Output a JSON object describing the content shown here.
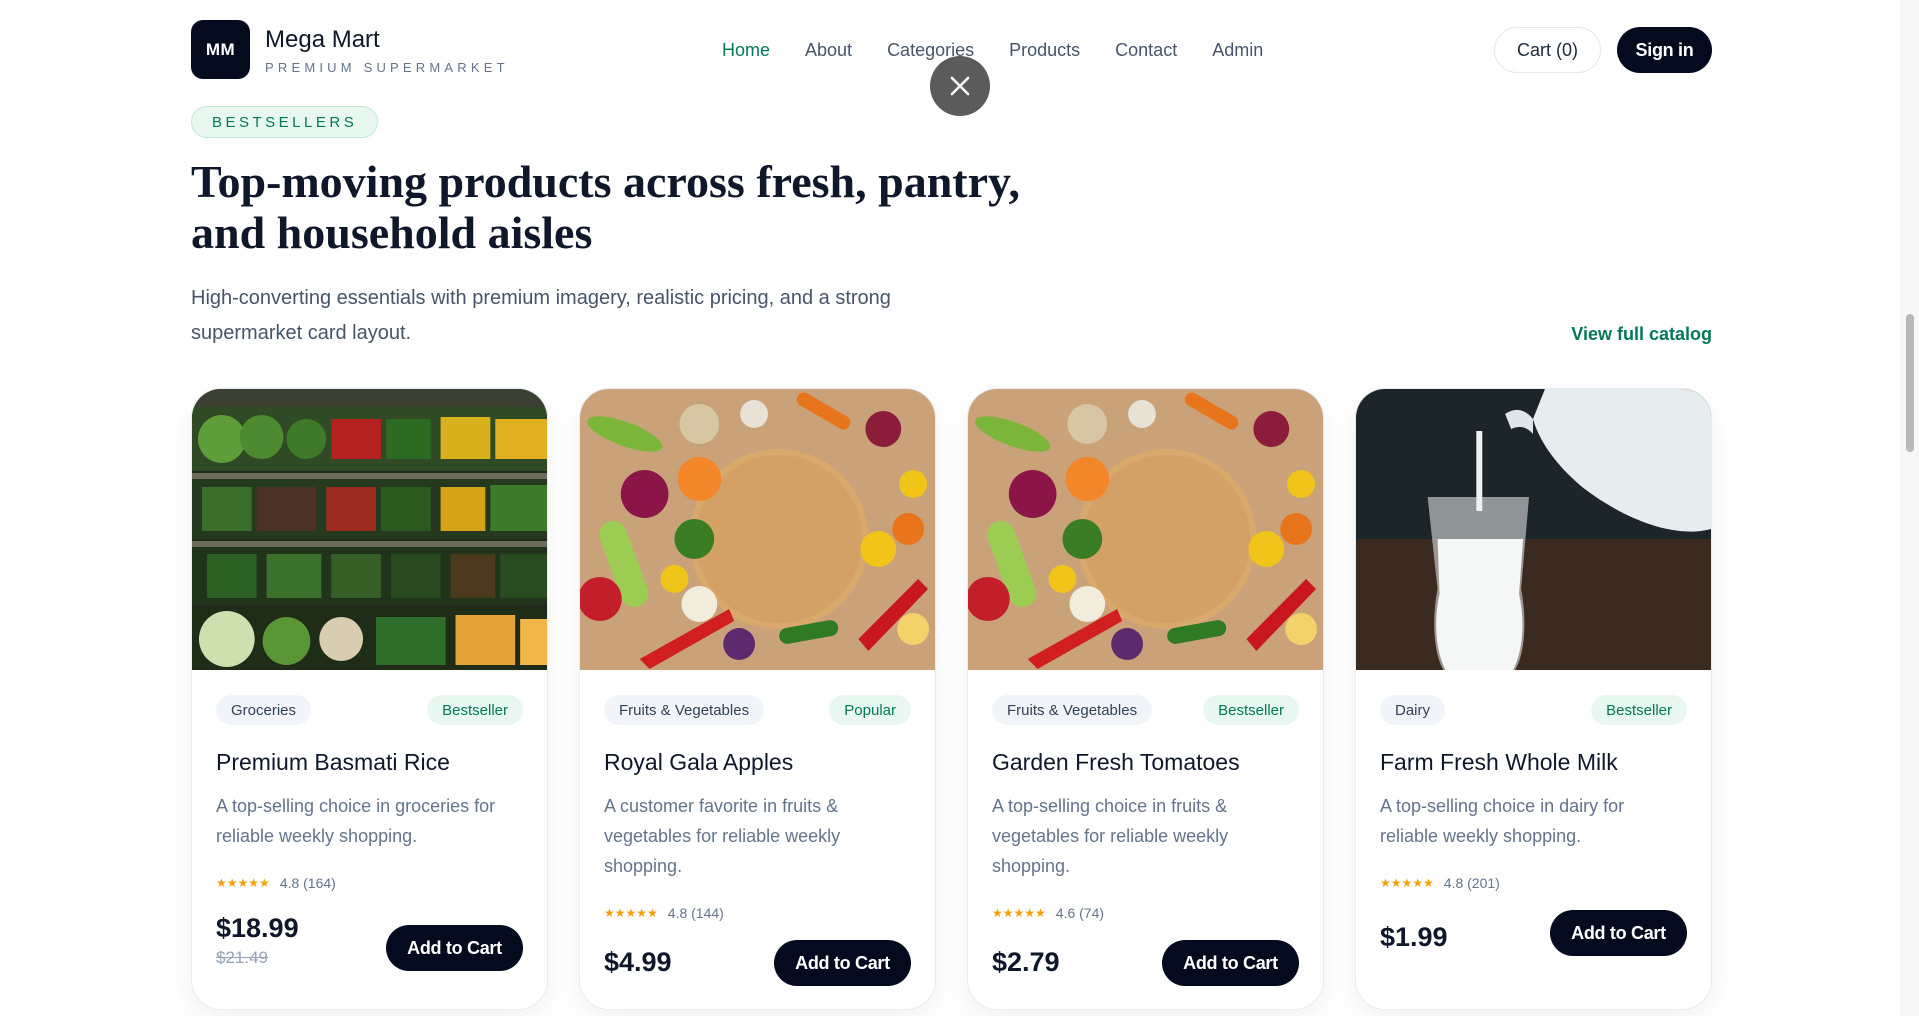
{
  "brand": {
    "logo_text": "MM",
    "name": "Mega Mart",
    "tagline": "PREMIUM SUPERMARKET"
  },
  "nav": [
    "Home",
    "About",
    "Categories",
    "Products",
    "Contact",
    "Admin"
  ],
  "active_nav": "Home",
  "header": {
    "cart_label": "Cart (0)",
    "signin_label": "Sign in"
  },
  "section": {
    "eyebrow": "BESTSELLERS",
    "headline": "Top-moving products across fresh, pantry, and household aisles",
    "subtitle": "High-converting essentials with premium imagery, realistic pricing, and a strong supermarket card layout.",
    "catalog_link": "View full catalog"
  },
  "products": [
    {
      "image": "supermarket-shelf-photo",
      "category": "Groceries",
      "badge": "Bestseller",
      "name": "Premium Basmati Rice",
      "description": "A top-selling choice in groceries for reliable weekly shopping.",
      "stars": "★★★★★",
      "rating": "4.8 (164)",
      "price": "$18.99",
      "old_price": "$21.49",
      "button": "Add to Cart"
    },
    {
      "image": "vegetables-board-photo",
      "category": "Fruits & Vegetables",
      "badge": "Popular",
      "name": "Royal Gala Apples",
      "description": "A customer favorite in fruits & vegetables for reliable weekly shopping.",
      "stars": "★★★★★",
      "rating": "4.8 (144)",
      "price": "$4.99",
      "old_price": "",
      "button": "Add to Cart"
    },
    {
      "image": "vegetables-board-photo",
      "category": "Fruits & Vegetables",
      "badge": "Bestseller",
      "name": "Garden Fresh Tomatoes",
      "description": "A top-selling choice in fruits & vegetables for reliable weekly shopping.",
      "stars": "★★★★★",
      "rating": "4.6 (74)",
      "price": "$2.79",
      "old_price": "",
      "button": "Add to Cart"
    },
    {
      "image": "milk-pour-photo",
      "category": "Dairy",
      "badge": "Bestseller",
      "name": "Farm Fresh Whole Milk",
      "description": "A top-selling choice in dairy for reliable weekly shopping.",
      "stars": "★★★★★",
      "rating": "4.8 (201)",
      "price": "$1.99",
      "old_price": "",
      "button": "Add to Cart"
    }
  ],
  "icons": {
    "close": "close-icon"
  },
  "colors": {
    "accent": "#047857",
    "dark": "#050b1f",
    "star": "#f59e0b"
  }
}
